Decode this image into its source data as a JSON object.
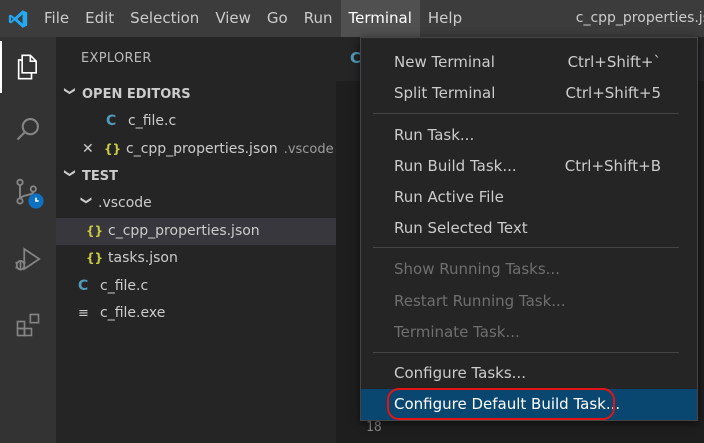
{
  "titlebar": {
    "logo_icon": "vscode-logo-icon",
    "menu": [
      "File",
      "Edit",
      "Selection",
      "View",
      "Go",
      "Run",
      "Terminal",
      "Help"
    ],
    "active_menu": "Terminal",
    "window_title": "c_cpp_properties.js"
  },
  "activitybar": {
    "items": [
      {
        "icon": "explorer-icon",
        "active": true
      },
      {
        "icon": "search-icon"
      },
      {
        "icon": "source-control-icon"
      },
      {
        "icon": "run-debug-icon"
      },
      {
        "icon": "extensions-icon"
      }
    ]
  },
  "sidebar": {
    "title": "EXPLORER",
    "open_editors": {
      "header": "OPEN EDITORS",
      "files": [
        {
          "icon": "C",
          "name": "c_file.c"
        },
        {
          "icon": "{}",
          "name": "c_cpp_properties.json",
          "desc": ".vscode",
          "close": "✕"
        }
      ]
    },
    "workspace": {
      "header": "TEST",
      "folder": ".vscode",
      "folder_files": [
        {
          "icon": "{}",
          "name": "c_cpp_properties.json"
        },
        {
          "icon": "{}",
          "name": "tasks.json"
        }
      ],
      "root_files": [
        {
          "icon": "C",
          "name": "c_file.c"
        },
        {
          "icon": "≡",
          "name": "c_file.exe"
        }
      ]
    }
  },
  "editor": {
    "tab_icon": "C",
    "line_number": "18"
  },
  "terminal_menu": {
    "groups": [
      [
        {
          "label": "New Terminal",
          "shortcut": "Ctrl+Shift+`"
        },
        {
          "label": "Split Terminal",
          "shortcut": "Ctrl+Shift+5"
        }
      ],
      [
        {
          "label": "Run Task...",
          "shortcut": ""
        },
        {
          "label": "Run Build Task...",
          "shortcut": "Ctrl+Shift+B"
        },
        {
          "label": "Run Active File",
          "shortcut": ""
        },
        {
          "label": "Run Selected Text",
          "shortcut": ""
        }
      ],
      [
        {
          "label": "Show Running Tasks...",
          "shortcut": "",
          "disabled": true
        },
        {
          "label": "Restart Running Task...",
          "shortcut": "",
          "disabled": true
        },
        {
          "label": "Terminate Task...",
          "shortcut": "",
          "disabled": true
        }
      ],
      [
        {
          "label": "Configure Tasks...",
          "shortcut": ""
        },
        {
          "label": "Configure Default Build Task...",
          "shortcut": "",
          "highlighted": true
        }
      ]
    ]
  },
  "colors": {
    "titlebar": "#3c3c3c",
    "activitybar": "#333333",
    "sidebar": "#252526",
    "highlight": "#094771",
    "annotation": "#e51414"
  }
}
